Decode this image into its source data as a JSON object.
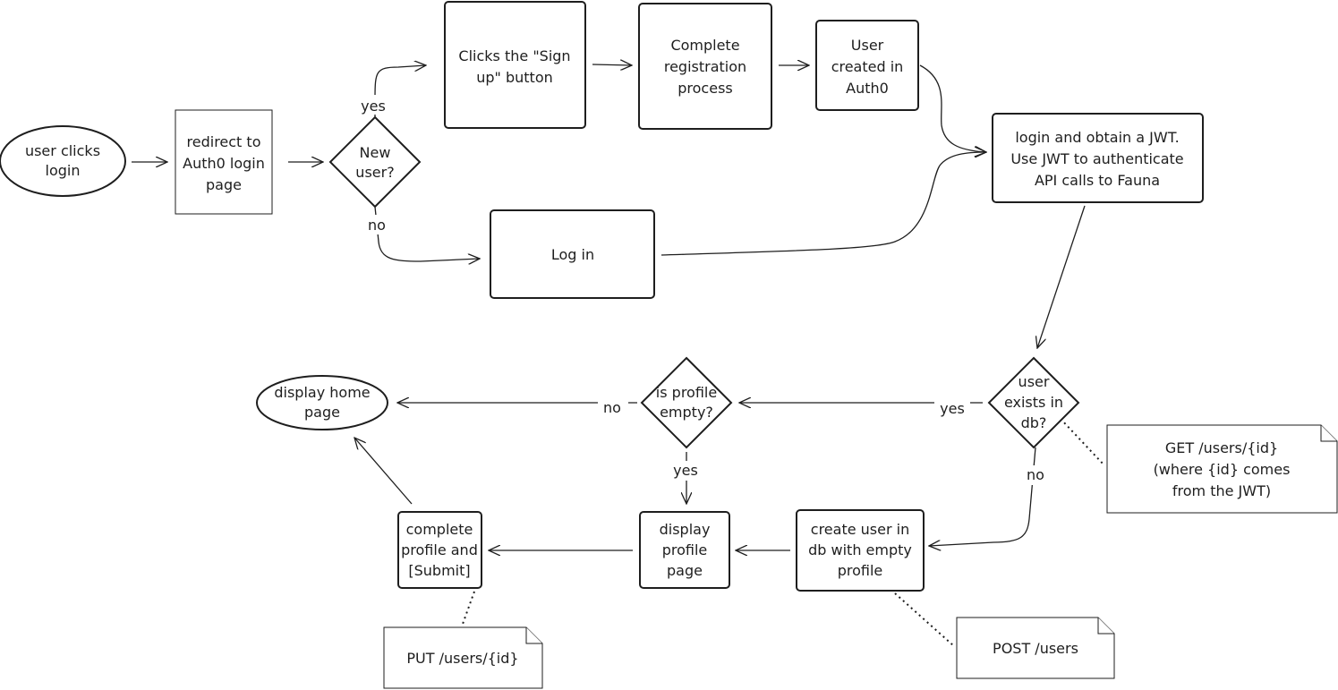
{
  "nodes": {
    "start": {
      "lines": [
        "user clicks",
        "login"
      ]
    },
    "redirect": {
      "lines": [
        "redirect to",
        "Auth0 login",
        "page"
      ]
    },
    "new_user": {
      "lines": [
        "New",
        "user?"
      ]
    },
    "signup": {
      "lines": [
        "Clicks the \"Sign",
        "up\" button"
      ]
    },
    "registration": {
      "lines": [
        "Complete",
        "registration",
        "process"
      ]
    },
    "created": {
      "lines": [
        "User",
        "created in",
        "Auth0"
      ]
    },
    "jwt": {
      "lines": [
        "login and obtain a JWT.",
        "Use JWT to authenticate",
        "API calls to Fauna"
      ]
    },
    "login": {
      "lines": [
        "Log in"
      ]
    },
    "exists": {
      "lines": [
        "user",
        "exists in",
        "db?"
      ]
    },
    "empty": {
      "lines": [
        "is profile",
        "empty?"
      ]
    },
    "home": {
      "lines": [
        "display home",
        "page"
      ]
    },
    "display_profile": {
      "lines": [
        "display",
        "profile",
        "page"
      ]
    },
    "create_user": {
      "lines": [
        "create user in",
        "db with empty",
        "profile"
      ]
    },
    "complete_profile": {
      "lines": [
        "complete",
        "profile and",
        "[Submit]"
      ]
    }
  },
  "notes": {
    "get": {
      "lines": [
        "GET /users/{id}",
        "(where {id} comes",
        "from the JWT)"
      ]
    },
    "post": {
      "lines": [
        "POST /users"
      ]
    },
    "put": {
      "lines": [
        "PUT /users/{id}"
      ]
    }
  },
  "edge_labels": {
    "new_user_yes": "yes",
    "new_user_no": "no",
    "exists_yes": "yes",
    "exists_no": "no",
    "empty_yes": "yes",
    "empty_no": "no"
  }
}
